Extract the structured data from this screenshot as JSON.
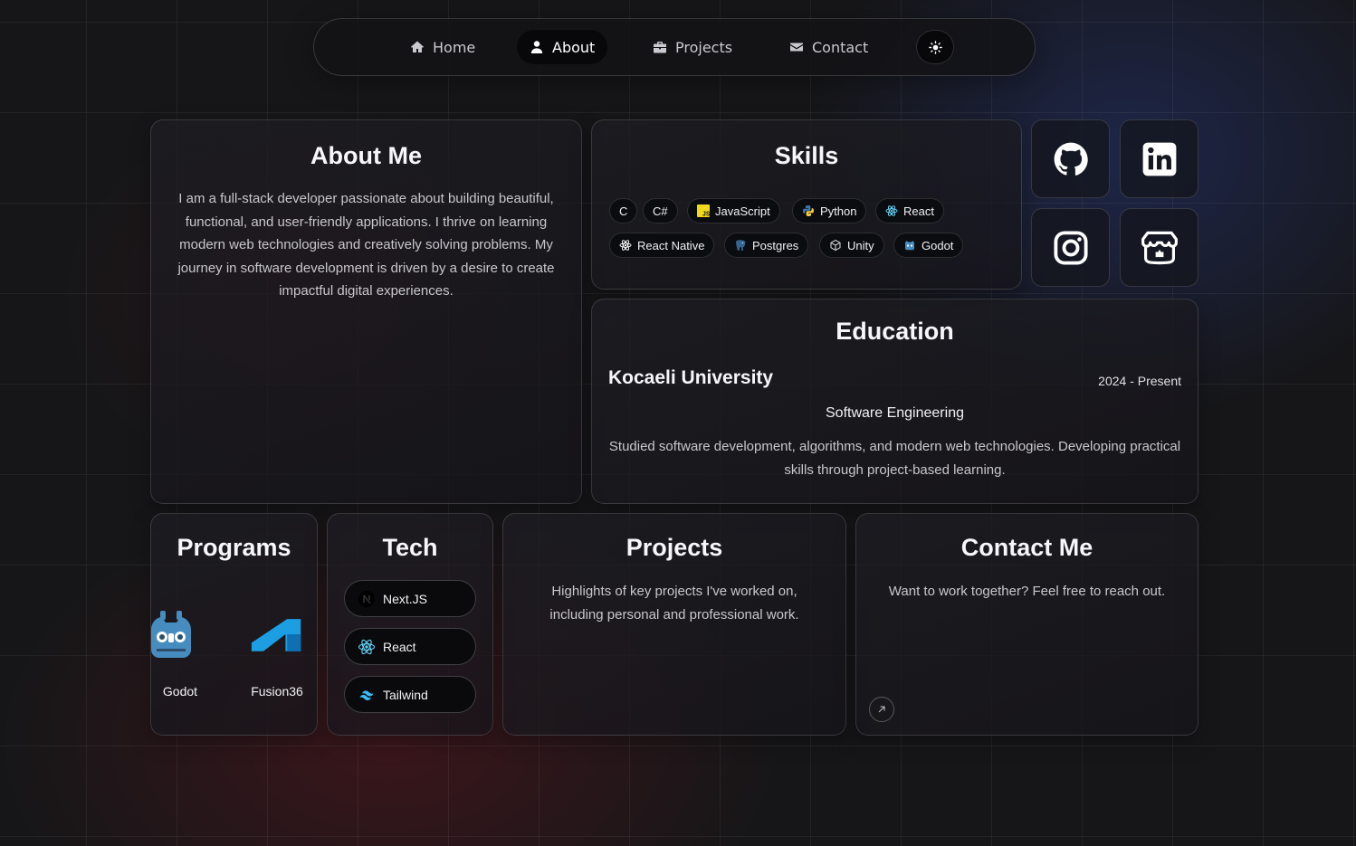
{
  "nav": {
    "items": [
      {
        "label": "Home",
        "icon": "home-icon"
      },
      {
        "label": "About",
        "icon": "user-icon",
        "active": true
      },
      {
        "label": "Projects",
        "icon": "briefcase-icon"
      },
      {
        "label": "Contact",
        "icon": "envelope-icon"
      }
    ],
    "theme_icon": "sun-icon"
  },
  "about": {
    "title": "About Me",
    "text": "I am a full-stack developer passionate about building beautiful, functional, and user-friendly applications. I thrive on learning modern web technologies and creatively solving problems. My journey in software development is driven by a desire to create impactful digital experiences."
  },
  "skills": {
    "title": "Skills",
    "items": [
      {
        "label": "C"
      },
      {
        "label": "C#"
      },
      {
        "label": "JavaScript",
        "icon": "javascript-icon"
      },
      {
        "label": "Python",
        "icon": "python-icon"
      },
      {
        "label": "React",
        "icon": "react-icon"
      },
      {
        "label": "React Native",
        "icon": "react-icon"
      },
      {
        "label": "Postgres",
        "icon": "postgres-icon"
      },
      {
        "label": "Unity",
        "icon": "unity-icon"
      },
      {
        "label": "Godot",
        "icon": "godot-icon"
      }
    ]
  },
  "socials": [
    "github-icon",
    "linkedin-icon",
    "instagram-icon",
    "itchio-icon"
  ],
  "education": {
    "title": "Education",
    "school": "Kocaeli University",
    "period": "2024 - Present",
    "degree": "Software Engineering",
    "description": "Studied software development, algorithms, and modern web technologies. Developing practical skills through project-based learning."
  },
  "programs": {
    "title": "Programs",
    "items": [
      {
        "label": "Godot",
        "icon": "godot-icon"
      },
      {
        "label": "Fusion36",
        "icon": "fusion360-icon"
      }
    ]
  },
  "tech": {
    "title": "Tech",
    "items": [
      {
        "label": "Next.JS",
        "icon": "nextjs-icon"
      },
      {
        "label": "React",
        "icon": "react-icon"
      },
      {
        "label": "Tailwind",
        "icon": "tailwind-icon"
      }
    ]
  },
  "projects": {
    "title": "Projects",
    "text": "Highlights of key projects I've worked on, including personal and professional work."
  },
  "contact": {
    "title": "Contact Me",
    "text": "Want to work together? Feel free to reach out.",
    "link_icon": "arrow-up-right-icon"
  },
  "colors": {
    "background": "#161618",
    "accent_blue": "#2b3c8c",
    "accent_red": "#5f161e",
    "card_border": "#2c2c32"
  }
}
